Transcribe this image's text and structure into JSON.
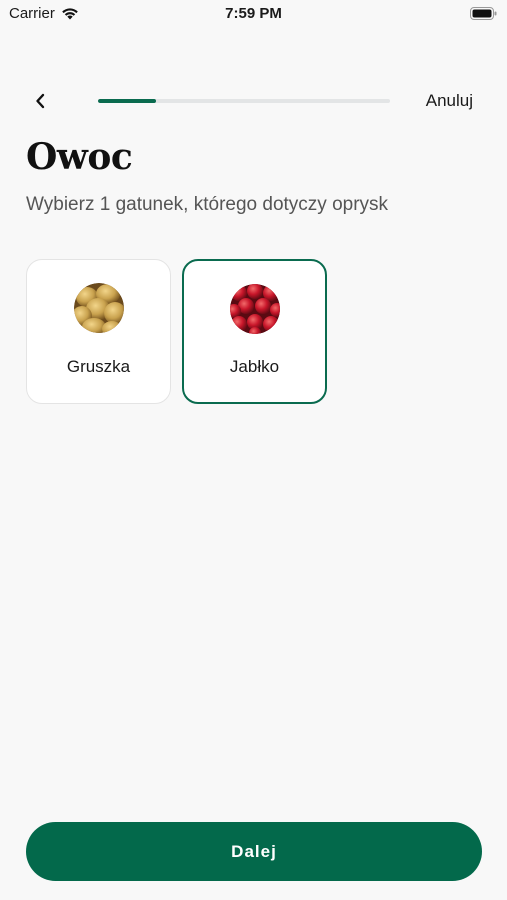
{
  "status_bar": {
    "carrier": "Carrier",
    "time": "7:59 PM"
  },
  "nav": {
    "cancel_label": "Anuluj",
    "progress_fraction": 0.2,
    "accent_color": "#0a6b4f"
  },
  "header": {
    "title": "Owoc",
    "subtitle": "Wybierz 1 gatunek, którego dotyczy oprysk"
  },
  "options": [
    {
      "label": "Gruszka",
      "icon": "pear-image",
      "selected": false
    },
    {
      "label": "Jabłko",
      "icon": "apple-image",
      "selected": true
    }
  ],
  "footer": {
    "next_label": "Dalej"
  }
}
